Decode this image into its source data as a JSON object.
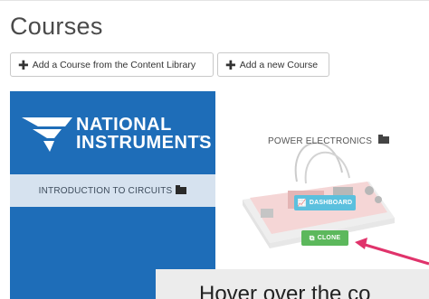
{
  "page": {
    "title": "Courses"
  },
  "toolbar": {
    "add_from_library_label": "Add a Course from the Content Library",
    "add_new_label": "Add a new Course",
    "plus_icon": "plus-icon"
  },
  "courses": [
    {
      "logo_line1": "NATIONAL",
      "logo_line2": "INSTRUMENTS",
      "logo_tm": "™",
      "title": "INTRODUCTION TO CIRCUITS",
      "icon": "folder-icon",
      "background": "#1e6db8"
    },
    {
      "title": "POWER ELECTRONICS",
      "icon": "folder-icon",
      "dashboard_label": "DASHBOARD",
      "clone_label": "CLONE",
      "dashboard_color": "#5bc0de",
      "clone_color": "#5cb85c"
    }
  ],
  "callout": {
    "text": "Hover over the co",
    "arrow_color": "#e0336b"
  }
}
